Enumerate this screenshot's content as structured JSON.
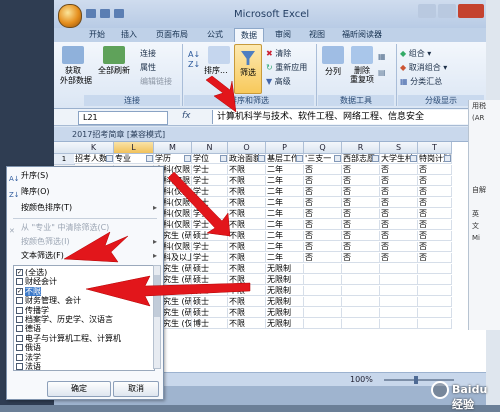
{
  "window": {
    "title": "Microsoft Excel"
  },
  "tabs": [
    "开始",
    "插入",
    "页面布局",
    "公式",
    "数据",
    "审阅",
    "视图",
    "福昕阅读器"
  ],
  "active_tab": "数据",
  "ribbon": {
    "get_external_label": "获取\n外部数据",
    "refresh_all_label": "全部刷新",
    "connections_label": "连接",
    "properties_label": "属性",
    "edit_links_label": "编辑链接",
    "group_connections": "连接",
    "sort_label": "排序...",
    "filter_label": "筛选",
    "clear_label": "清除",
    "reapply_label": "重新应用",
    "advanced_label": "高级",
    "group_sort_filter": "排序和筛选",
    "text_to_columns_label": "分列",
    "remove_duplicates_label": "删除\n重复项",
    "group_data_tools": "数据工具",
    "group_label": "组合",
    "ungroup_label": "取消组合",
    "subtotal_label": "分类汇总",
    "group_outline": "分级显示"
  },
  "formula_bar": {
    "name_box": "L21",
    "fx": "fx",
    "formula": "计算机科学与技术、软件工程、网络工程、信息安全"
  },
  "workbook_title": "2017招考简章  [兼容模式]",
  "sheet": {
    "columns": [
      "K",
      "L",
      "M",
      "N",
      "O",
      "P",
      "Q",
      "R",
      "S",
      "T"
    ],
    "header_row": [
      "招考人数",
      "专业",
      "学历",
      "学位",
      "政治面貌",
      "基层工作",
      "'三支一",
      "西部志愿",
      "大学生村",
      "特岗计划"
    ],
    "rows": [
      [
        "",
        "",
        "本科(仅限)",
        "学士",
        "不限",
        "二年",
        "否",
        "否",
        "否",
        "否"
      ],
      [
        "",
        "",
        "本科(仅限)",
        "学士",
        "不限",
        "二年",
        "否",
        "否",
        "否",
        "否"
      ],
      [
        "",
        "",
        "本科(仅限)",
        "学士",
        "不限",
        "二年",
        "否",
        "否",
        "否",
        "否"
      ],
      [
        "",
        "",
        "本科(仅限)",
        "学士",
        "不限",
        "二年",
        "否",
        "否",
        "否",
        "否"
      ],
      [
        "",
        "",
        "本科(仅限)",
        "学士",
        "不限",
        "二年",
        "否",
        "否",
        "否",
        "否"
      ],
      [
        "",
        "",
        "本科(仅限)",
        "学士",
        "不限",
        "二年",
        "否",
        "否",
        "否",
        "否"
      ],
      [
        "",
        "",
        "研究生 (研",
        "硕士",
        "不限",
        "二年",
        "否",
        "否",
        "否",
        "否"
      ],
      [
        "",
        "",
        "本科(仅限)",
        "学士",
        "不限",
        "二年",
        "否",
        "否",
        "否",
        "否"
      ],
      [
        "",
        "",
        "本科及以上",
        "学士",
        "不限",
        "二年",
        "否",
        "否",
        "否",
        "否"
      ],
      [
        "",
        "",
        "研究生 (研",
        "硕士",
        "不限",
        "无限制",
        "",
        "",
        "",
        ""
      ],
      [
        "",
        "",
        "研究生 (研",
        "硕士",
        "不限",
        "无限制",
        "",
        "",
        "",
        ""
      ],
      [
        "",
        "",
        "研究生 (研",
        "硕士",
        "不限",
        "无限制",
        "",
        "",
        "",
        ""
      ],
      [
        "",
        "",
        "研究生 (研",
        "硕士",
        "不限",
        "无限制",
        "",
        "",
        "",
        ""
      ],
      [
        "",
        "",
        "研究生 (研",
        "硕士",
        "不限",
        "无限制",
        "",
        "",
        "",
        ""
      ],
      [
        "",
        "",
        "研究生 (仅博士",
        "博士",
        "不限",
        "无限制",
        "",
        "",
        "",
        ""
      ]
    ]
  },
  "status": {
    "zoom": "100%"
  },
  "filter_menu": {
    "sort_asc": "升序(S)",
    "sort_desc": "降序(O)",
    "sort_by_color": "按颜色排序(T)",
    "clear_filter": "从 \"专业\" 中清除筛选(C)",
    "filter_by_color": "按颜色筛选(I)",
    "text_filter": "文本筛选(F)",
    "items": [
      {
        "label": "(全选)",
        "checked": true
      },
      {
        "label": "财经会计",
        "checked": false
      },
      {
        "label": "不限",
        "checked": true
      },
      {
        "label": "财务管理、会计",
        "checked": false
      },
      {
        "label": "传播学",
        "checked": false
      },
      {
        "label": "档案学、历史学、汉语言",
        "checked": false
      },
      {
        "label": "德语",
        "checked": false
      },
      {
        "label": "电子与计算机工程、计算机",
        "checked": false
      },
      {
        "label": "俄语",
        "checked": false
      },
      {
        "label": "法学",
        "checked": false
      },
      {
        "label": "法语",
        "checked": false
      }
    ],
    "ok_label": "确定",
    "cancel_label": "取消"
  },
  "right_fragment": [
    "用税",
    "(AR",
    "",
    "",
    "",
    "",
    "",
    "自解",
    "",
    "英",
    "文",
    "Mi"
  ],
  "watermark": "Baidu 经验",
  "colors": {
    "accent": "#3b79c9",
    "arrow": "#e2161b",
    "ribbon": "#dbe6f4"
  }
}
